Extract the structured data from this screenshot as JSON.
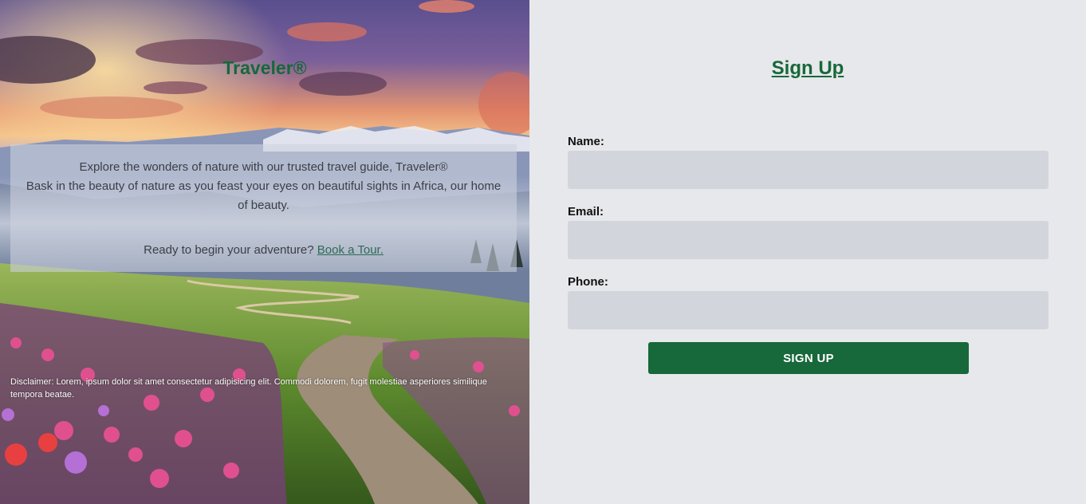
{
  "hero": {
    "brand": "Traveler®",
    "intro_line1": "Explore the wonders of nature with our trusted travel guide, Traveler®",
    "intro_line2": "Bask in the beauty of nature as you feast your eyes on beautiful sights in Africa, our home of beauty.",
    "cta_text": "Ready to begin your adventure?",
    "cta_link": "Book a Tour.",
    "disclaimer": "Disclaimer: Lorem, ipsum dolor sit amet consectetur adipisicing elit. Commodi dolorem, fugit molestiae asperiores similique tempora beatae."
  },
  "form": {
    "title": "Sign Up",
    "name_label": "Name:",
    "name_value": "",
    "email_label": "Email:",
    "email_value": "",
    "phone_label": "Phone:",
    "phone_value": "",
    "submit_label": "SIGN UP"
  },
  "colors": {
    "accent": "#17683a",
    "panel_bg": "#e7e8eb",
    "input_bg": "#d2d5db"
  }
}
